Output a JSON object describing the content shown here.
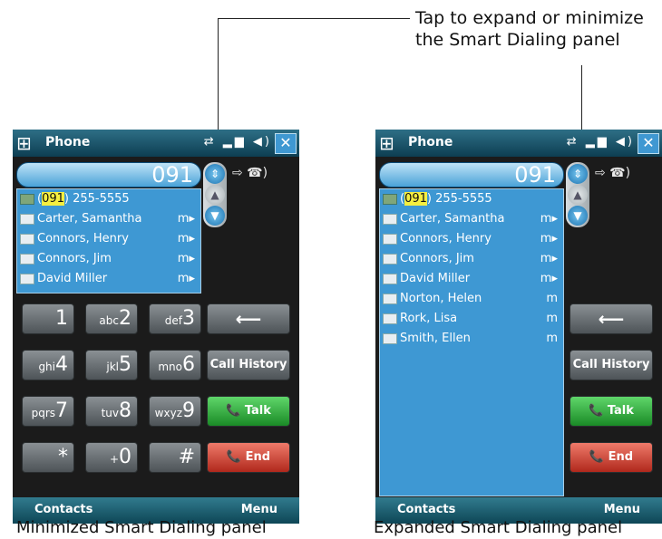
{
  "callout": {
    "line1": "Tap to expand or minimize",
    "line2": "the Smart Dialing panel"
  },
  "screens": {
    "left": {
      "caption": "Minimized Smart Dialing panel",
      "title": "Phone",
      "dial_number": "091",
      "rows": [
        {
          "pre": "(",
          "match": "091",
          "post": ") 255-5555",
          "type": "",
          "icon": "person-icon"
        },
        {
          "pre": "",
          "match": "",
          "post": "Carter, Samantha",
          "type": "m▸",
          "icon": "contact-card-icon"
        },
        {
          "pre": "",
          "match": "",
          "post": "Connors, Henry",
          "type": "m▸",
          "icon": "contact-card-icon"
        },
        {
          "pre": "",
          "match": "",
          "post": "Connors, Jim",
          "type": "m▸",
          "icon": "contact-card-icon"
        },
        {
          "pre": "",
          "match": "",
          "post": "David Miller",
          "type": "m▸",
          "icon": "contact-card-icon"
        }
      ],
      "keypad": [
        {
          "sub": "",
          "main": "1"
        },
        {
          "sub": "abc",
          "main": "2"
        },
        {
          "sub": "def",
          "main": "3"
        },
        {
          "sub": "ghi",
          "main": "4"
        },
        {
          "sub": "jkl",
          "main": "5"
        },
        {
          "sub": "mno",
          "main": "6"
        },
        {
          "sub": "pqrs",
          "main": "7"
        },
        {
          "sub": "tuv",
          "main": "8"
        },
        {
          "sub": "wxyz",
          "main": "9"
        },
        {
          "sub": "",
          "main": "*"
        },
        {
          "sub": "+",
          "main": "0"
        },
        {
          "sub": "",
          "main": "#"
        }
      ],
      "backspace": "⟵",
      "call_history": "Call History",
      "talk": "📞 Talk",
      "end": "📞 End",
      "soft_left": "Contacts",
      "soft_right": "Menu"
    },
    "right": {
      "caption": "Expanded Smart Dialing panel",
      "title": "Phone",
      "dial_number": "091",
      "rows": [
        {
          "pre": "(",
          "match": "091",
          "post": ") 255-5555",
          "type": "",
          "icon": "person-icon"
        },
        {
          "pre": "",
          "match": "",
          "post": "Carter, Samantha",
          "type": "m▸",
          "icon": "contact-card-icon"
        },
        {
          "pre": "",
          "match": "",
          "post": "Connors, Henry",
          "type": "m▸",
          "icon": "contact-card-icon"
        },
        {
          "pre": "",
          "match": "",
          "post": "Connors, Jim",
          "type": "m▸",
          "icon": "contact-card-icon"
        },
        {
          "pre": "",
          "match": "",
          "post": "David Miller",
          "type": "m▸",
          "icon": "contact-card-icon"
        },
        {
          "pre": "",
          "match": "",
          "post": "Norton, Helen",
          "type": "m",
          "icon": "contact-card-icon"
        },
        {
          "pre": "",
          "match": "",
          "post": "Rork, Lisa",
          "type": "m",
          "icon": "contact-card-icon"
        },
        {
          "pre": "",
          "match": "",
          "post": "Smith, Ellen",
          "type": "m",
          "icon": "contact-card-icon"
        }
      ],
      "backspace": "⟵",
      "call_history": "Call History",
      "talk": "📞 Talk",
      "end": "📞 End",
      "soft_left": "Contacts",
      "soft_right": "Menu"
    }
  },
  "colors": {
    "panel": "#3e98d3",
    "highlight": "#f5ef40",
    "talk": "#1a8a26",
    "end": "#b0281c"
  }
}
